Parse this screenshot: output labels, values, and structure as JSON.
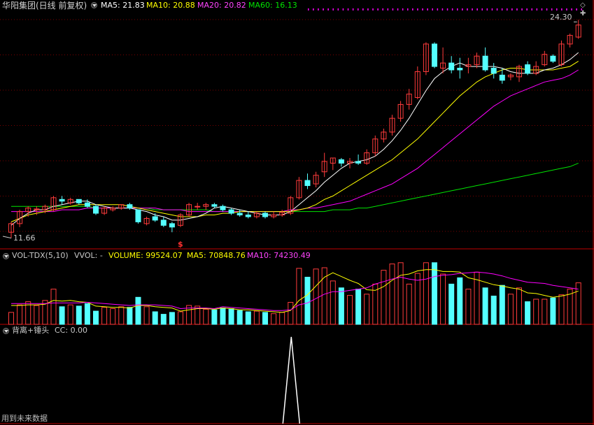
{
  "colors": {
    "up": "#ff3b3b",
    "down": "#54ffff",
    "ma5": "#ffffff",
    "ma10": "#ffff00",
    "ma20": "#ff00ff",
    "ma60": "#00e400",
    "grid": "#7a0000",
    "axis": "#c00000",
    "spike": "#ffffff"
  },
  "price_panel": {
    "title": "华阳集团(日线 前复权)",
    "ma5_label": "MA5: 21.83",
    "ma10_label": "MA10: 20.88",
    "ma20_label": "MA20: 20.82",
    "ma60_label": "MA60: 16.13",
    "high_label": "24.30",
    "low_label": "11.66",
    "marker": "$",
    "right_icons": [
      "diamond-icon",
      "plus-icon"
    ]
  },
  "volume_panel": {
    "title": "VOL-TDX(5,10)",
    "vvol": "VVOL: -",
    "volume_label": "VOLUME: 99524.07",
    "ma5_label": "MA5: 70848.76",
    "ma10_label": "MA10: 74230.49"
  },
  "indicator_panel": {
    "title": "背离+锤头",
    "cc_label": "CC: 0.00",
    "footer": "用到未来数据"
  },
  "chart_data": {
    "type": "candlestick",
    "title": "华阳集团(日线 前复权)",
    "ohlc": [
      [
        12.0,
        12.6,
        11.66,
        12.5
      ],
      [
        12.5,
        13.3,
        12.3,
        13.2
      ],
      [
        13.2,
        13.5,
        12.9,
        13.4
      ],
      [
        13.3,
        13.5,
        13.0,
        13.35
      ],
      [
        13.3,
        13.6,
        13.1,
        13.5
      ],
      [
        13.3,
        14.1,
        13.2,
        14.0
      ],
      [
        13.9,
        14.1,
        13.6,
        13.8
      ],
      [
        13.7,
        14.0,
        13.6,
        13.9
      ],
      [
        13.9,
        13.9,
        13.6,
        13.7
      ],
      [
        13.7,
        13.9,
        13.4,
        13.5
      ],
      [
        13.5,
        13.6,
        13.0,
        13.1
      ],
      [
        13.1,
        13.5,
        13.0,
        13.4
      ],
      [
        13.3,
        13.5,
        13.2,
        13.4
      ],
      [
        13.4,
        13.6,
        13.3,
        13.6
      ],
      [
        13.6,
        13.7,
        13.3,
        13.4
      ],
      [
        13.3,
        13.3,
        12.5,
        12.6
      ],
      [
        12.5,
        12.9,
        12.4,
        12.8
      ],
      [
        12.9,
        13.1,
        12.6,
        12.7
      ],
      [
        12.7,
        12.9,
        12.3,
        12.4
      ],
      [
        12.5,
        12.6,
        12.0,
        12.3
      ],
      [
        12.4,
        13.1,
        12.3,
        13.0
      ],
      [
        13.0,
        13.7,
        12.9,
        13.6
      ],
      [
        13.5,
        13.7,
        13.3,
        13.5
      ],
      [
        13.5,
        13.7,
        13.3,
        13.6
      ],
      [
        13.6,
        13.7,
        13.4,
        13.5
      ],
      [
        13.5,
        13.6,
        13.2,
        13.3
      ],
      [
        13.3,
        13.4,
        13.0,
        13.1
      ],
      [
        13.1,
        13.3,
        12.9,
        13.0
      ],
      [
        13.0,
        13.2,
        12.8,
        12.9
      ],
      [
        12.9,
        13.2,
        12.8,
        13.1
      ],
      [
        13.1,
        13.2,
        12.8,
        12.9
      ],
      [
        12.9,
        13.2,
        12.8,
        13.0
      ],
      [
        13.0,
        13.3,
        12.9,
        13.15
      ],
      [
        13.1,
        14.1,
        13.0,
        14.0
      ],
      [
        14.0,
        15.2,
        13.9,
        15.0
      ],
      [
        15.0,
        15.4,
        14.5,
        14.7
      ],
      [
        14.8,
        15.5,
        14.6,
        15.3
      ],
      [
        15.5,
        16.6,
        15.2,
        16.1
      ],
      [
        16.0,
        16.3,
        15.6,
        16.3
      ],
      [
        16.2,
        16.3,
        15.8,
        16.0
      ],
      [
        16.0,
        16.3,
        15.7,
        16.1
      ],
      [
        16.1,
        16.5,
        15.9,
        16.0
      ],
      [
        16.0,
        16.8,
        15.9,
        16.6
      ],
      [
        16.6,
        17.6,
        16.4,
        17.4
      ],
      [
        17.4,
        18.0,
        17.2,
        17.8
      ],
      [
        17.8,
        18.8,
        17.6,
        18.6
      ],
      [
        18.6,
        19.6,
        18.4,
        19.4
      ],
      [
        19.4,
        20.3,
        19.1,
        20.0
      ],
      [
        19.8,
        21.6,
        19.7,
        21.3
      ],
      [
        21.3,
        23.0,
        21.1,
        22.9
      ],
      [
        22.9,
        23.0,
        21.5,
        21.6
      ],
      [
        21.5,
        22.7,
        21.2,
        21.8
      ],
      [
        21.8,
        22.2,
        21.2,
        21.4
      ],
      [
        21.5,
        22.1,
        20.9,
        21.4
      ],
      [
        21.6,
        22.1,
        21.2,
        21.7
      ],
      [
        21.7,
        22.4,
        21.5,
        22.2
      ],
      [
        22.2,
        22.7,
        21.3,
        21.4
      ],
      [
        21.5,
        21.8,
        20.9,
        21.2
      ],
      [
        21.1,
        21.5,
        20.6,
        20.8
      ],
      [
        21.0,
        21.2,
        20.8,
        21.1
      ],
      [
        21.0,
        21.7,
        20.7,
        21.6
      ],
      [
        21.7,
        21.9,
        21.1,
        21.2
      ],
      [
        21.2,
        21.9,
        21.1,
        21.6
      ],
      [
        21.7,
        22.5,
        21.6,
        22.3
      ],
      [
        22.2,
        22.3,
        21.8,
        21.9
      ],
      [
        21.7,
        23.1,
        21.6,
        22.9
      ],
      [
        22.9,
        23.5,
        22.7,
        23.4
      ],
      [
        23.3,
        24.3,
        23.2,
        24.0
      ]
    ],
    "volume": [
      19,
      31,
      36,
      30,
      38,
      56,
      28,
      31,
      29,
      33,
      21,
      27,
      25,
      28,
      27,
      43,
      28,
      20,
      16,
      19,
      20,
      30,
      29,
      24,
      23,
      26,
      25,
      22,
      20,
      21,
      19,
      17,
      19,
      35,
      89,
      75,
      88,
      90,
      69,
      58,
      46,
      56,
      48,
      64,
      86,
      96,
      98,
      64,
      81,
      98,
      98,
      80,
      64,
      74,
      56,
      83,
      58,
      45,
      62,
      48,
      58,
      36,
      40,
      40,
      42,
      47,
      56,
      66
    ],
    "ma5": [
      12.4,
      12.8,
      13.1,
      13.3,
      13.3,
      13.5,
      13.6,
      13.7,
      13.8,
      13.8,
      13.6,
      13.5,
      13.4,
      13.4,
      13.4,
      13.3,
      13.2,
      13.0,
      12.9,
      12.7,
      12.7,
      12.8,
      12.9,
      13.1,
      13.4,
      13.5,
      13.4,
      13.3,
      13.2,
      13.1,
      13.0,
      13.0,
      13.0,
      13.2,
      13.6,
      14.0,
      14.4,
      14.9,
      15.3,
      15.7,
      16.0,
      16.1,
      16.2,
      16.4,
      16.8,
      17.3,
      17.9,
      18.6,
      19.4,
      20.2,
      20.9,
      21.3,
      21.6,
      21.8,
      21.6,
      21.6,
      21.6,
      21.6,
      21.5,
      21.3,
      21.2,
      21.2,
      21.2,
      21.4,
      21.5,
      21.7,
      22.0,
      22.4
    ],
    "ma10": [
      12.6,
      12.8,
      13.0,
      13.1,
      13.2,
      13.3,
      13.4,
      13.5,
      13.6,
      13.6,
      13.6,
      13.6,
      13.6,
      13.6,
      13.5,
      13.4,
      13.3,
      13.2,
      13.1,
      13.0,
      12.9,
      12.9,
      12.9,
      13.0,
      13.0,
      13.1,
      13.1,
      13.2,
      13.2,
      13.2,
      13.2,
      13.2,
      13.2,
      13.2,
      13.3,
      13.4,
      13.6,
      13.9,
      14.1,
      14.4,
      14.7,
      15.0,
      15.3,
      15.6,
      15.9,
      16.2,
      16.6,
      17.0,
      17.4,
      17.9,
      18.4,
      18.9,
      19.4,
      19.9,
      20.3,
      20.7,
      21.0,
      21.2,
      21.4,
      21.5,
      21.5,
      21.4,
      21.4,
      21.4,
      21.4,
      21.5,
      21.6,
      21.9
    ],
    "ma20": [
      13.2,
      13.2,
      13.2,
      13.2,
      13.2,
      13.2,
      13.3,
      13.3,
      13.3,
      13.4,
      13.4,
      13.4,
      13.4,
      13.4,
      13.4,
      13.4,
      13.4,
      13.4,
      13.3,
      13.3,
      13.3,
      13.2,
      13.2,
      13.2,
      13.2,
      13.2,
      13.2,
      13.2,
      13.2,
      13.2,
      13.2,
      13.2,
      13.2,
      13.3,
      13.3,
      13.4,
      13.4,
      13.5,
      13.6,
      13.7,
      13.8,
      14.0,
      14.2,
      14.4,
      14.6,
      14.8,
      15.1,
      15.4,
      15.7,
      16.1,
      16.5,
      16.9,
      17.3,
      17.7,
      18.1,
      18.5,
      18.9,
      19.3,
      19.6,
      19.9,
      20.1,
      20.3,
      20.5,
      20.7,
      20.8,
      20.9,
      21.1,
      21.4
    ],
    "ma60": [
      13.5,
      13.5,
      13.5,
      13.5,
      13.5,
      13.5,
      13.5,
      13.5,
      13.5,
      13.5,
      13.4,
      13.4,
      13.4,
      13.4,
      13.4,
      13.4,
      13.4,
      13.3,
      13.3,
      13.3,
      13.3,
      13.3,
      13.3,
      13.3,
      13.2,
      13.2,
      13.2,
      13.2,
      13.2,
      13.2,
      13.2,
      13.2,
      13.2,
      13.2,
      13.2,
      13.2,
      13.2,
      13.2,
      13.3,
      13.3,
      13.3,
      13.4,
      13.4,
      13.5,
      13.6,
      13.7,
      13.8,
      13.9,
      14.0,
      14.1,
      14.2,
      14.3,
      14.4,
      14.5,
      14.6,
      14.7,
      14.8,
      14.9,
      15.0,
      15.1,
      15.2,
      15.3,
      15.4,
      15.5,
      15.6,
      15.7,
      15.8,
      16.0
    ],
    "vol_ma5": [
      30,
      30,
      31,
      31,
      32,
      38,
      37,
      38,
      36,
      35,
      29,
      28,
      27,
      27,
      26,
      30,
      30,
      28,
      27,
      26,
      21,
      23,
      25,
      25,
      24,
      26,
      25,
      23,
      23,
      22,
      21,
      20,
      19,
      22,
      38,
      47,
      61,
      75,
      82,
      76,
      70,
      65,
      55,
      54,
      60,
      70,
      78,
      80,
      85,
      87,
      87,
      84,
      84,
      83,
      74,
      71,
      67,
      63,
      61,
      58,
      56,
      50,
      49,
      46,
      43,
      45,
      48,
      53
    ],
    "vol_ma10": [
      33,
      33,
      33,
      33,
      33,
      34,
      34,
      34,
      34,
      35,
      34,
      33,
      32,
      31,
      30,
      31,
      31,
      31,
      30,
      29,
      25,
      26,
      26,
      26,
      25,
      28,
      27,
      26,
      25,
      24,
      23,
      22,
      22,
      23,
      31,
      34,
      41,
      48,
      52,
      52,
      54,
      56,
      58,
      64,
      68,
      72,
      75,
      72,
      70,
      72,
      76,
      78,
      79,
      81,
      82,
      83,
      82,
      80,
      77,
      73,
      70,
      67,
      66,
      65,
      62,
      60,
      58,
      56
    ],
    "spike": {
      "index": 33,
      "value": 1
    },
    "ylim": [
      11.2,
      24.8
    ],
    "vol_ylim": [
      0,
      100
    ],
    "markers": {
      "high": "24.30",
      "low": "11.66"
    }
  }
}
